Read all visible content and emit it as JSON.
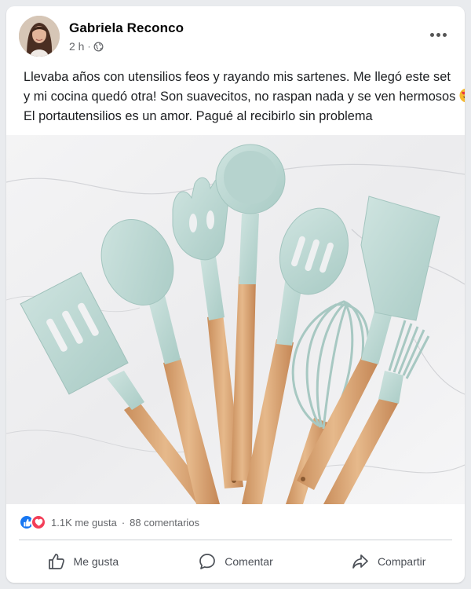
{
  "post": {
    "author": "Gabriela Reconco",
    "time": "2 h",
    "text_lines": [
      "Llevaba años con utensilios feos y rayando mis sartenes. Me llegó este set",
      "y mi cocina quedó otra! Son suavecitos, no raspan nada y se ven hermosos",
      "El portautensilios es un amor. Pagué al recibirlo sin problema"
    ],
    "emoji": "heart-eyes-emoji"
  },
  "engagement": {
    "likes": "1.1K me gusta",
    "separator": "·",
    "comments": "88 comentarios"
  },
  "actions": {
    "like": "Me gusta",
    "comment": "Comentar",
    "share": "Compartir"
  },
  "icons": [
    "globe-icon",
    "more-icon",
    "like-reaction-icon",
    "love-reaction-icon",
    "thumbs-up-icon",
    "comment-icon",
    "share-icon"
  ],
  "colors": {
    "like_blue": "#1877f2",
    "love_red": "#f33e58",
    "silicone_mint": "#bcd9d4",
    "wood": "#d9a877"
  }
}
